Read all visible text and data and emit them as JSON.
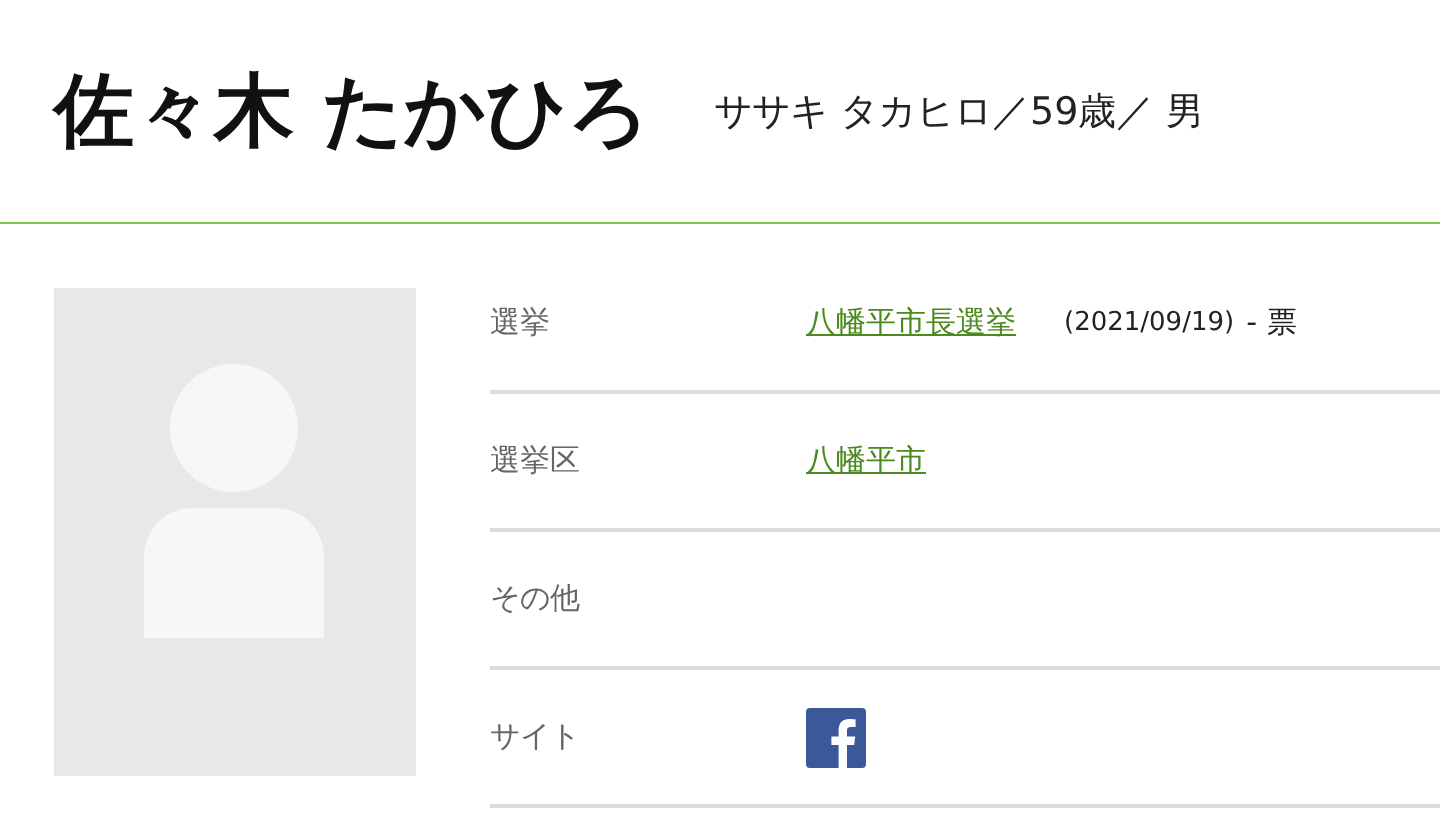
{
  "profile": {
    "name": "佐々木 たかひろ",
    "details": "ササキ タカヒロ／59歳／ 男"
  },
  "photo": {
    "kind": "avatar"
  },
  "rows": [
    {
      "kind": "election",
      "label": "選挙",
      "link": "八幡平市長選挙",
      "date": "(2021/09/19)",
      "votes": "- 票"
    },
    {
      "kind": "link",
      "label": "選挙区",
      "link": "八幡平市"
    },
    {
      "kind": "empty",
      "label": "その他"
    },
    {
      "kind": "social",
      "label": "サイト"
    }
  ]
}
